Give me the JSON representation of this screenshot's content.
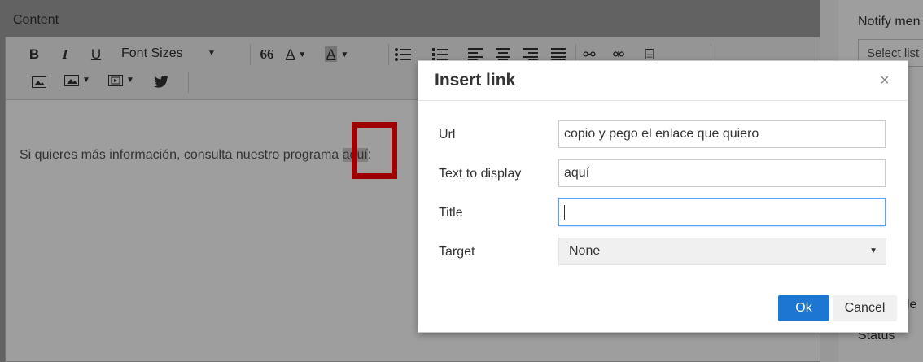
{
  "background": {
    "content_label": "Content",
    "toolbar": {
      "bold": "B",
      "italic": "I",
      "underline": "U",
      "font_sizes": "Font Sizes",
      "quote": "66",
      "text_color": "A",
      "bg_color": "A"
    },
    "editor_text_before": "Si quieres más información, consulta nuestro programa ",
    "editor_text_selected": "aquí",
    "editor_text_after": ":",
    "notify_label": "Notify men",
    "select_list": "Select list",
    "status_label": "Status",
    "ple_text": "ple"
  },
  "dialog": {
    "title": "Insert link",
    "close": "×",
    "url_label": "Url",
    "url_value": "copio y pego el enlace que quiero",
    "text_label": "Text to display",
    "text_value": "aquí",
    "title_label": "Title",
    "title_value": "",
    "target_label": "Target",
    "target_value": "None",
    "ok_label": "Ok",
    "cancel_label": "Cancel"
  },
  "colors": {
    "accent": "#1c76d2",
    "highlight": "#ff0000"
  }
}
